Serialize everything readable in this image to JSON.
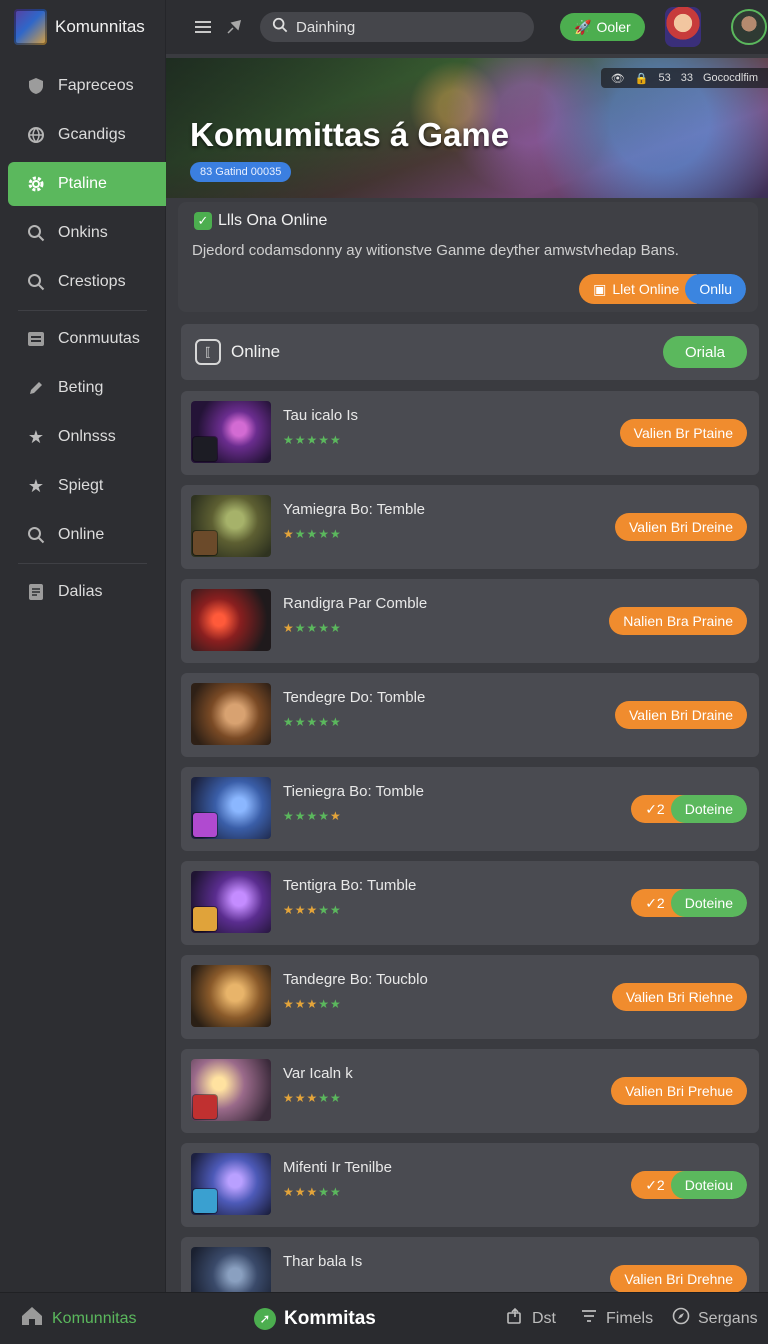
{
  "app": {
    "name": "Komunnitas",
    "icon": "game-cube-icon"
  },
  "sidebar": {
    "items": [
      {
        "label": "Fapreceos",
        "icon": "shield-icon"
      },
      {
        "label": "Gcandigs",
        "icon": "globe-icon"
      },
      {
        "label": "Ptaline",
        "icon": "gear-icon",
        "active": true
      },
      {
        "label": "Onkins",
        "icon": "search-icon"
      },
      {
        "label": "Crestiops",
        "icon": "search-icon"
      },
      {
        "label": "Conmuutas",
        "icon": "list-icon"
      },
      {
        "label": "Beting",
        "icon": "pencil-icon"
      },
      {
        "label": "Onlnsss",
        "icon": "star-icon"
      },
      {
        "label": "Spiegt",
        "icon": "star-icon"
      },
      {
        "label": "Online",
        "icon": "search-icon"
      },
      {
        "label": "Dalias",
        "icon": "document-icon"
      }
    ]
  },
  "topbar": {
    "search_value": "Dainhing",
    "button_label": "Ooler",
    "accent": "#4cae4f"
  },
  "hero": {
    "title": "Komumittas á Game",
    "badge": "83 Gatind 00035",
    "stats": [
      "53",
      "33",
      "Gococdlfim"
    ]
  },
  "info": {
    "title": "Llls Ona Online",
    "description": "Djedord codamsdonny ay witionstve Ganme deyther amwstvhedap Bans.",
    "primary_label": "Llet Online",
    "secondary_label": "Onllu"
  },
  "online_section": {
    "label": "Online",
    "pill": "Oriala"
  },
  "games": [
    {
      "title": "Tau icalo Is",
      "stars": 5,
      "star_color": "green",
      "action": "Valien Br Ptaine",
      "type": "single"
    },
    {
      "title": "Yamiegra Bo: Temble",
      "stars": 5,
      "star_color": "mixed",
      "action": "Valien Bri Dreine",
      "type": "single"
    },
    {
      "title": "Randigra Par Comble",
      "stars": 5,
      "star_color": "mixed",
      "action": "Nalien Bra Praine",
      "type": "single"
    },
    {
      "title": "Tendegre Do: Tomble",
      "stars": 5,
      "star_color": "green",
      "action": "Valien Bri Draine",
      "type": "single"
    },
    {
      "title": "Tieniegra Bo: Tomble",
      "stars": 4,
      "star_color": "green",
      "action_left": "✓2",
      "action_right": "Doteine",
      "type": "split"
    },
    {
      "title": "Tentigra Bo: Tumble",
      "stars": 4,
      "star_color": "gold",
      "action_left": "✓2",
      "action_right": "Doteine",
      "type": "split"
    },
    {
      "title": "Tandegre Bo: Toucblo",
      "stars": 4,
      "star_color": "gold",
      "action": "Valien Bri Riehne",
      "type": "single"
    },
    {
      "title": "Var Icaln k",
      "stars": 4,
      "star_color": "gold",
      "action": "Valien Bri Prehue",
      "type": "single"
    },
    {
      "title": "Mifenti Ir Tenilbe",
      "stars": 4,
      "star_color": "gold",
      "action_left": "✓2",
      "action_right": "Doteiou",
      "type": "split"
    },
    {
      "title": "Thar bala Is",
      "stars": 0,
      "star_color": "gold",
      "action": "Valien Bri Drehne",
      "type": "single"
    }
  ],
  "bottombar": {
    "home_label": "Komunnitas",
    "center_label": "Kommitas",
    "items": [
      {
        "label": "Dst",
        "icon": "share-icon"
      },
      {
        "label": "Fimels",
        "icon": "filter-icon"
      },
      {
        "label": "Sergans",
        "icon": "compass-icon"
      }
    ]
  }
}
